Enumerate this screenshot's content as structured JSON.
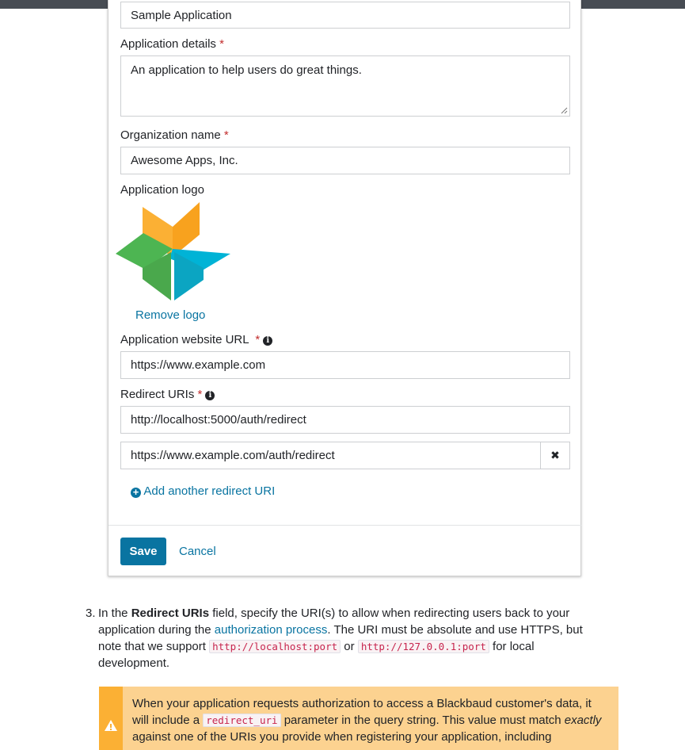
{
  "form": {
    "app_name_value": "Sample Application",
    "details_label": "Application details",
    "details_value": "An application to help users do great things.",
    "org_label": "Organization name",
    "org_value": "Awesome Apps, Inc.",
    "logo_label": "Application logo",
    "remove_logo": "Remove logo",
    "website_label": "Application website URL",
    "website_value": "https://www.example.com",
    "redirect_label": "Redirect URIs",
    "redirect_uris": [
      "http://localhost:5000/auth/redirect",
      "https://www.example.com/auth/redirect"
    ],
    "add_redirect": "Add another redirect URI",
    "required_mark": "*",
    "info_glyph": "i",
    "remove_glyph": "✖",
    "add_glyph": "+",
    "save": "Save",
    "cancel": "Cancel"
  },
  "step": {
    "number": "3.",
    "t1": "In the ",
    "bold": "Redirect URIs",
    "t2": " field, specify the URI(s) to allow when redirecting users back to your application during the ",
    "link": "authorization process",
    "t3": ". The URI must be absolute and use HTTPS, but note that we support ",
    "code1": "http://localhost:port",
    "t4": " or ",
    "code2": "http://127.0.0.1:port",
    "t5": " for local development."
  },
  "warning": {
    "t1": "When your application requests authorization to access a Blackbaud customer's data, it will include a ",
    "code": "redirect_uri",
    "t2": " parameter in the query string. This value must match ",
    "em": "exactly",
    "t3": " against one of the URIs you provide when registering your application, including"
  },
  "colors": {
    "accent": "#0974a1",
    "required": "#c22d2d",
    "warning_bg": "#fcd290",
    "warning_bar": "#fbb034"
  },
  "icons": [
    "info-icon",
    "close-icon",
    "plus-circle-icon",
    "warning-icon",
    "app-logo"
  ]
}
